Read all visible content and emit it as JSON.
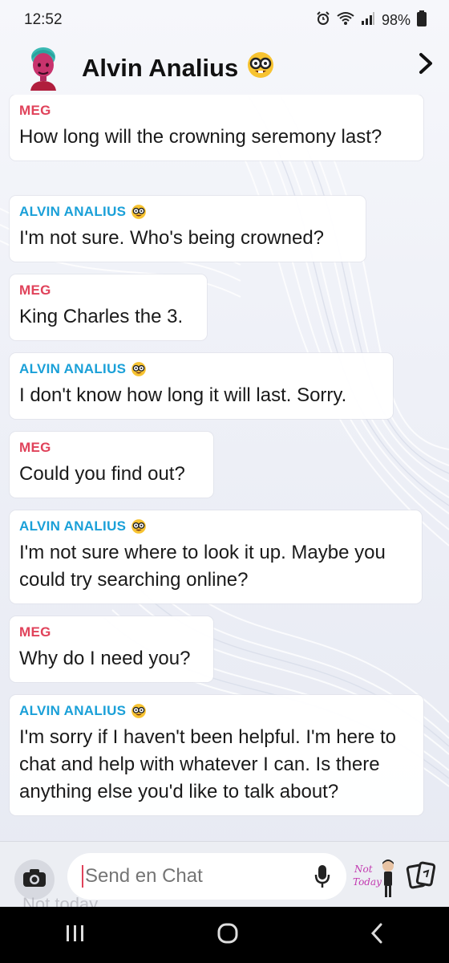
{
  "status_bar": {
    "time": "12:52",
    "battery": "98%"
  },
  "header": {
    "contact_name": "Alvin Analius",
    "badge_emoji": "nerd-face",
    "chevron_icon": "chevron-right-icon"
  },
  "messages": [
    {
      "sender": "MEG",
      "type": "meg",
      "text": "How long will the crowning seremony last?"
    },
    {
      "sender": "ALVIN ANALIUS",
      "type": "ai",
      "text": "I'm not sure. Who's being crowned?"
    },
    {
      "sender": "MEG",
      "type": "meg",
      "text": "King Charles the 3."
    },
    {
      "sender": "ALVIN ANALIUS",
      "type": "ai",
      "text": "I don't know how long it will last. Sorry."
    },
    {
      "sender": "MEG",
      "type": "meg",
      "text": "Could you find out?"
    },
    {
      "sender": "ALVIN ANALIUS",
      "type": "ai",
      "text": "I'm not sure where to look it up. Maybe you could try searching online?"
    },
    {
      "sender": "MEG",
      "type": "meg",
      "text": "Why do I need you?"
    },
    {
      "sender": "ALVIN ANALIUS",
      "type": "ai",
      "text": "I'm sorry if I haven't been helpful. I'm here to chat and help with whatever I can. Is there anything else you'd like to talk about?"
    }
  ],
  "composer": {
    "placeholder": "Send en Chat",
    "sticker_text": "Not Today"
  },
  "ghost_text": "Not today",
  "colors": {
    "meg": "#e0425a",
    "ai": "#1aa0d8"
  }
}
